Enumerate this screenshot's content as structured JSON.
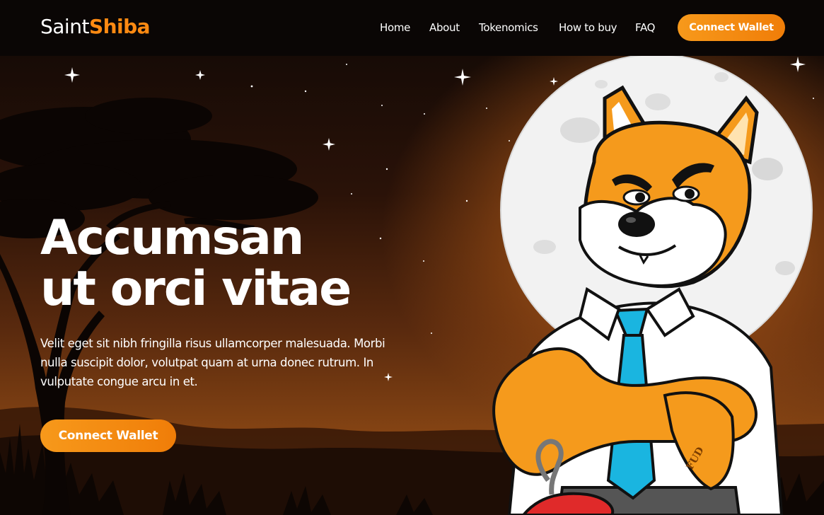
{
  "brand": {
    "name_part1": "Saint",
    "name_part2": "Shiba"
  },
  "nav": {
    "items": [
      "Home",
      "About",
      "Tokenomics",
      "How to buy",
      "FAQ"
    ],
    "cta_label": "Connect Wallet"
  },
  "hero": {
    "headline_line1": "Accumsan",
    "headline_line2": "ut orci vitae",
    "description": "Velit eget sit nibh fringilla risus ullamcorper malesuada. Morbi nulla suscipit dolor, volutpat quam at urna donec rutrum. In vulputate congue arcu in et.",
    "cta_label": "Connect Wallet",
    "tattoo_text": "FUD"
  },
  "colors": {
    "accent": "#f7911a",
    "header_bg": "#0a0605",
    "sky_dark": "#170b06",
    "sky_glow": "#b8651c",
    "moon": "#f2f2f2",
    "shiba_orange": "#f59a1c",
    "tie_blue": "#1ab5e0"
  }
}
